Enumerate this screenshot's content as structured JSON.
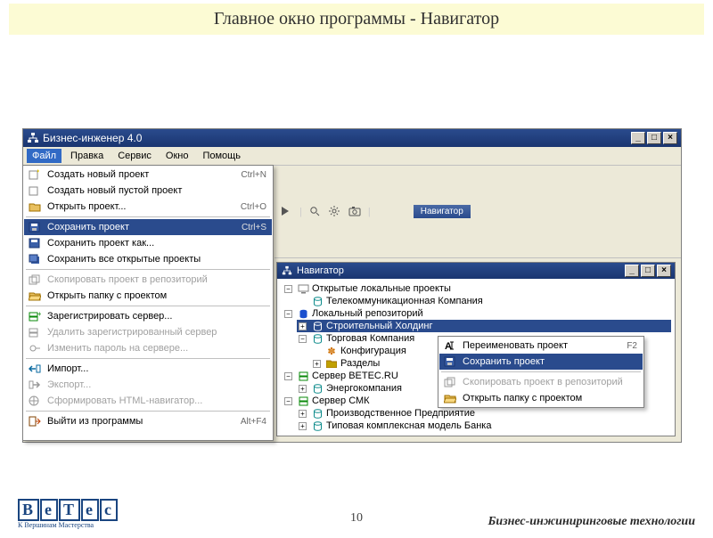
{
  "slide": {
    "title": "Главное окно программы - Навигатор",
    "page": "10",
    "tagline": "Бизнес-инжиниринговые технологии",
    "logo_sub": "К Вершинам Мастерства"
  },
  "app": {
    "title": "Бизнес-инженер 4.0"
  },
  "menubar": {
    "file": "Файл",
    "edit": "Правка",
    "service": "Сервис",
    "window": "Окно",
    "help": "Помощь"
  },
  "toolbar": {
    "nav_chip": "Навигатор"
  },
  "file_menu": {
    "items": [
      {
        "label": "Создать новый проект",
        "shortcut": "Ctrl+N",
        "icon": "new-project-icon",
        "disabled": false
      },
      {
        "label": "Создать новый пустой проект",
        "shortcut": "",
        "icon": "new-empty-project-icon",
        "disabled": false
      },
      {
        "label": "Открыть проект...",
        "shortcut": "Ctrl+O",
        "icon": "open-project-icon",
        "disabled": false
      },
      {
        "label": "Сохранить проект",
        "shortcut": "Ctrl+S",
        "icon": "save-project-icon",
        "disabled": false,
        "selected": true
      },
      {
        "label": "Сохранить проект как...",
        "shortcut": "",
        "icon": "save-as-icon",
        "disabled": false
      },
      {
        "label": "Сохранить все открытые проекты",
        "shortcut": "",
        "icon": "save-all-icon",
        "disabled": false
      },
      {
        "label": "Скопировать проект в репозиторий",
        "shortcut": "",
        "icon": "copy-to-repo-icon",
        "disabled": true
      },
      {
        "label": "Открыть папку с проектом",
        "shortcut": "",
        "icon": "open-folder-icon",
        "disabled": false
      },
      {
        "label": "Зарегистрировать сервер...",
        "shortcut": "",
        "icon": "register-server-icon",
        "disabled": false
      },
      {
        "label": "Удалить зарегистрированный сервер",
        "shortcut": "",
        "icon": "remove-server-icon",
        "disabled": true
      },
      {
        "label": "Изменить пароль на сервере...",
        "shortcut": "",
        "icon": "change-password-icon",
        "disabled": true
      },
      {
        "label": "Импорт...",
        "shortcut": "",
        "icon": "import-icon",
        "disabled": false
      },
      {
        "label": "Экспорт...",
        "shortcut": "",
        "icon": "export-icon",
        "disabled": true
      },
      {
        "label": "Сформировать HTML-навигатор...",
        "shortcut": "",
        "icon": "html-nav-icon",
        "disabled": true
      },
      {
        "label": "Выйти из программы",
        "shortcut": "Alt+F4",
        "icon": "exit-icon",
        "disabled": false
      }
    ]
  },
  "navigator": {
    "title": "Навигатор",
    "tree": {
      "root0": "Открытые локальные проекты",
      "root0_0": "Телекоммуникационная Компания",
      "root1": "Локальный репозиторий",
      "root1_0": "Строительный Холдинг",
      "root1_1": "Торговая Компания",
      "root1_1_0": "Конфигурация",
      "root1_1_1": "Разделы",
      "root2": "Сервер BETEC.RU",
      "root2_0": "Энергокомпания",
      "root3": "Сервер СМК",
      "root3_0": "Производственное Предприятие",
      "root3_1": "Типовая комплексная модель Банка"
    }
  },
  "context_menu": {
    "items": [
      {
        "label": "Переименовать проект",
        "shortcut": "F2",
        "icon": "rename-icon",
        "disabled": false
      },
      {
        "label": "Сохранить проект",
        "shortcut": "",
        "icon": "save-project-icon",
        "disabled": false,
        "selected": true
      },
      {
        "label": "Скопировать проект в репозиторий",
        "shortcut": "",
        "icon": "copy-to-repo-icon",
        "disabled": true
      },
      {
        "label": "Открыть папку с проектом",
        "shortcut": "",
        "icon": "open-folder-icon",
        "disabled": false
      }
    ]
  }
}
